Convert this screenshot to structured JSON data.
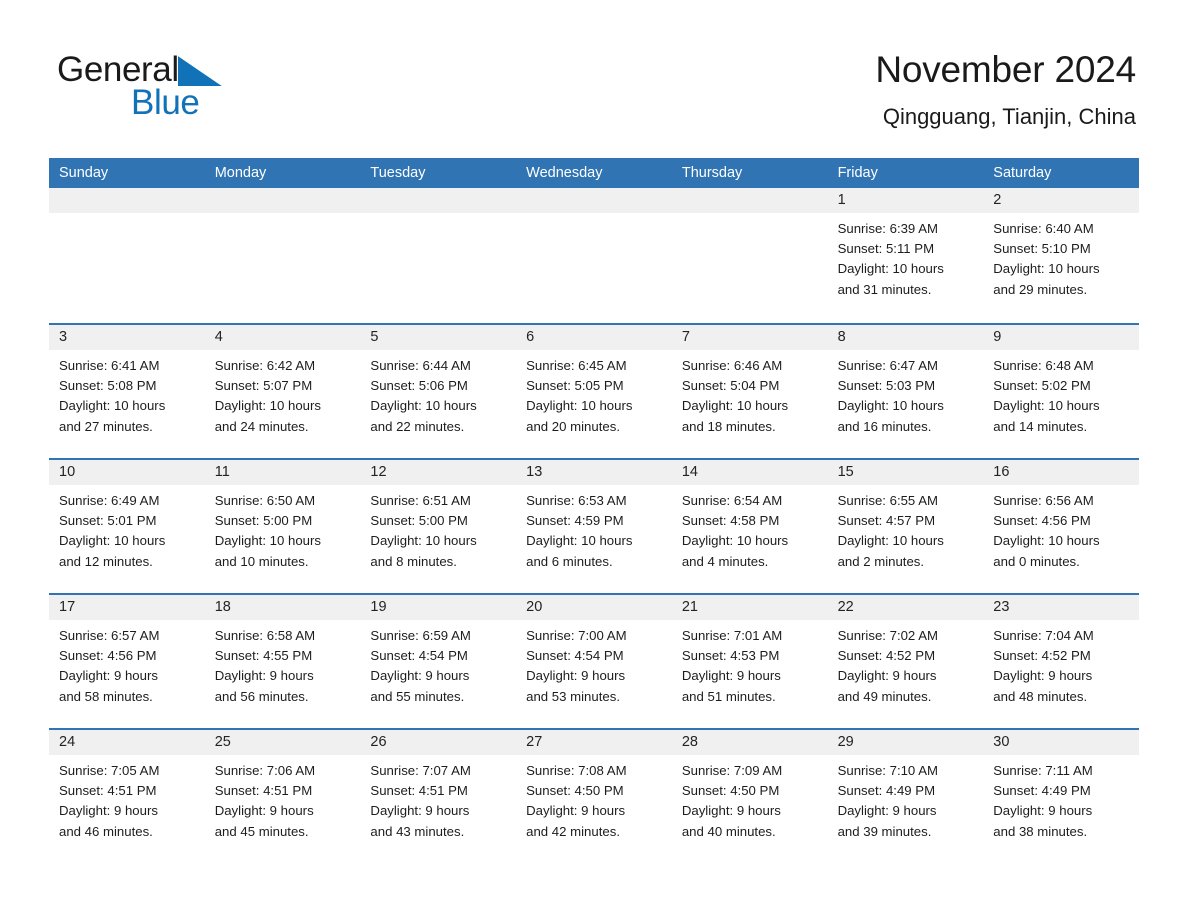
{
  "brand": {
    "name_part1": "General",
    "name_part2": "Blue",
    "accent_color": "#1272b8"
  },
  "header": {
    "title": "November 2024",
    "subtitle": "Qingguang, Tianjin, China"
  },
  "theme": {
    "header_blue": "#3074b3",
    "daynum_band": "#f0f0f0",
    "text": "#1d1d1d"
  },
  "weekdays": [
    "Sunday",
    "Monday",
    "Tuesday",
    "Wednesday",
    "Thursday",
    "Friday",
    "Saturday"
  ],
  "weeks": [
    [
      {
        "day": "",
        "lines": []
      },
      {
        "day": "",
        "lines": []
      },
      {
        "day": "",
        "lines": []
      },
      {
        "day": "",
        "lines": []
      },
      {
        "day": "",
        "lines": []
      },
      {
        "day": "1",
        "lines": [
          "Sunrise: 6:39 AM",
          "Sunset: 5:11 PM",
          "Daylight: 10 hours",
          "and 31 minutes."
        ]
      },
      {
        "day": "2",
        "lines": [
          "Sunrise: 6:40 AM",
          "Sunset: 5:10 PM",
          "Daylight: 10 hours",
          "and 29 minutes."
        ]
      }
    ],
    [
      {
        "day": "3",
        "lines": [
          "Sunrise: 6:41 AM",
          "Sunset: 5:08 PM",
          "Daylight: 10 hours",
          "and 27 minutes."
        ]
      },
      {
        "day": "4",
        "lines": [
          "Sunrise: 6:42 AM",
          "Sunset: 5:07 PM",
          "Daylight: 10 hours",
          "and 24 minutes."
        ]
      },
      {
        "day": "5",
        "lines": [
          "Sunrise: 6:44 AM",
          "Sunset: 5:06 PM",
          "Daylight: 10 hours",
          "and 22 minutes."
        ]
      },
      {
        "day": "6",
        "lines": [
          "Sunrise: 6:45 AM",
          "Sunset: 5:05 PM",
          "Daylight: 10 hours",
          "and 20 minutes."
        ]
      },
      {
        "day": "7",
        "lines": [
          "Sunrise: 6:46 AM",
          "Sunset: 5:04 PM",
          "Daylight: 10 hours",
          "and 18 minutes."
        ]
      },
      {
        "day": "8",
        "lines": [
          "Sunrise: 6:47 AM",
          "Sunset: 5:03 PM",
          "Daylight: 10 hours",
          "and 16 minutes."
        ]
      },
      {
        "day": "9",
        "lines": [
          "Sunrise: 6:48 AM",
          "Sunset: 5:02 PM",
          "Daylight: 10 hours",
          "and 14 minutes."
        ]
      }
    ],
    [
      {
        "day": "10",
        "lines": [
          "Sunrise: 6:49 AM",
          "Sunset: 5:01 PM",
          "Daylight: 10 hours",
          "and 12 minutes."
        ]
      },
      {
        "day": "11",
        "lines": [
          "Sunrise: 6:50 AM",
          "Sunset: 5:00 PM",
          "Daylight: 10 hours",
          "and 10 minutes."
        ]
      },
      {
        "day": "12",
        "lines": [
          "Sunrise: 6:51 AM",
          "Sunset: 5:00 PM",
          "Daylight: 10 hours",
          "and 8 minutes."
        ]
      },
      {
        "day": "13",
        "lines": [
          "Sunrise: 6:53 AM",
          "Sunset: 4:59 PM",
          "Daylight: 10 hours",
          "and 6 minutes."
        ]
      },
      {
        "day": "14",
        "lines": [
          "Sunrise: 6:54 AM",
          "Sunset: 4:58 PM",
          "Daylight: 10 hours",
          "and 4 minutes."
        ]
      },
      {
        "day": "15",
        "lines": [
          "Sunrise: 6:55 AM",
          "Sunset: 4:57 PM",
          "Daylight: 10 hours",
          "and 2 minutes."
        ]
      },
      {
        "day": "16",
        "lines": [
          "Sunrise: 6:56 AM",
          "Sunset: 4:56 PM",
          "Daylight: 10 hours",
          "and 0 minutes."
        ]
      }
    ],
    [
      {
        "day": "17",
        "lines": [
          "Sunrise: 6:57 AM",
          "Sunset: 4:56 PM",
          "Daylight: 9 hours",
          "and 58 minutes."
        ]
      },
      {
        "day": "18",
        "lines": [
          "Sunrise: 6:58 AM",
          "Sunset: 4:55 PM",
          "Daylight: 9 hours",
          "and 56 minutes."
        ]
      },
      {
        "day": "19",
        "lines": [
          "Sunrise: 6:59 AM",
          "Sunset: 4:54 PM",
          "Daylight: 9 hours",
          "and 55 minutes."
        ]
      },
      {
        "day": "20",
        "lines": [
          "Sunrise: 7:00 AM",
          "Sunset: 4:54 PM",
          "Daylight: 9 hours",
          "and 53 minutes."
        ]
      },
      {
        "day": "21",
        "lines": [
          "Sunrise: 7:01 AM",
          "Sunset: 4:53 PM",
          "Daylight: 9 hours",
          "and 51 minutes."
        ]
      },
      {
        "day": "22",
        "lines": [
          "Sunrise: 7:02 AM",
          "Sunset: 4:52 PM",
          "Daylight: 9 hours",
          "and 49 minutes."
        ]
      },
      {
        "day": "23",
        "lines": [
          "Sunrise: 7:04 AM",
          "Sunset: 4:52 PM",
          "Daylight: 9 hours",
          "and 48 minutes."
        ]
      }
    ],
    [
      {
        "day": "24",
        "lines": [
          "Sunrise: 7:05 AM",
          "Sunset: 4:51 PM",
          "Daylight: 9 hours",
          "and 46 minutes."
        ]
      },
      {
        "day": "25",
        "lines": [
          "Sunrise: 7:06 AM",
          "Sunset: 4:51 PM",
          "Daylight: 9 hours",
          "and 45 minutes."
        ]
      },
      {
        "day": "26",
        "lines": [
          "Sunrise: 7:07 AM",
          "Sunset: 4:51 PM",
          "Daylight: 9 hours",
          "and 43 minutes."
        ]
      },
      {
        "day": "27",
        "lines": [
          "Sunrise: 7:08 AM",
          "Sunset: 4:50 PM",
          "Daylight: 9 hours",
          "and 42 minutes."
        ]
      },
      {
        "day": "28",
        "lines": [
          "Sunrise: 7:09 AM",
          "Sunset: 4:50 PM",
          "Daylight: 9 hours",
          "and 40 minutes."
        ]
      },
      {
        "day": "29",
        "lines": [
          "Sunrise: 7:10 AM",
          "Sunset: 4:49 PM",
          "Daylight: 9 hours",
          "and 39 minutes."
        ]
      },
      {
        "day": "30",
        "lines": [
          "Sunrise: 7:11 AM",
          "Sunset: 4:49 PM",
          "Daylight: 9 hours",
          "and 38 minutes."
        ]
      }
    ]
  ]
}
